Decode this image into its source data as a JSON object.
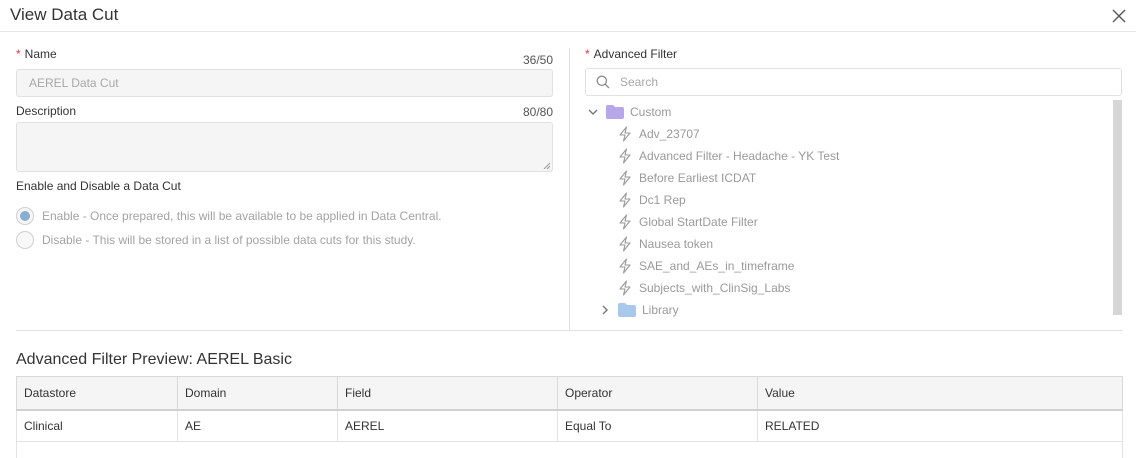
{
  "dialog": {
    "title": "View Data Cut"
  },
  "name_field": {
    "label": "Name",
    "counter": "36/50",
    "value": "AEREL Data Cut"
  },
  "description_field": {
    "label": "Description",
    "counter": "80/80",
    "value": ""
  },
  "enable_section": {
    "label": "Enable and Disable a Data Cut",
    "options": [
      {
        "label": "Enable - Once prepared, this will be available to be applied in Data Central.",
        "selected": true
      },
      {
        "label": "Disable - This will be stored in a list of possible data cuts for this study.",
        "selected": false
      }
    ]
  },
  "advanced_filter": {
    "label": "Advanced Filter",
    "search_placeholder": "Search",
    "folders": [
      {
        "name": "Custom",
        "expanded": true,
        "color": "#b7a6e8",
        "items": [
          "Adv_23707",
          "Advanced Filter - Headache - YK Test",
          "Before Earliest ICDAT",
          "Dc1 Rep",
          "Global StartDate Filter",
          "Nausea token",
          "SAE_and_AEs_in_timeframe",
          "Subjects_with_ClinSig_Labs"
        ]
      },
      {
        "name": "Library",
        "expanded": false,
        "color": "#a9c9ec",
        "items": []
      }
    ]
  },
  "preview": {
    "title": "Advanced Filter Preview: AEREL Basic",
    "columns": [
      "Datastore",
      "Domain",
      "Field",
      "Operator",
      "Value"
    ],
    "rows": [
      [
        "Clinical",
        "AE",
        "AEREL",
        "Equal To",
        "RELATED"
      ]
    ]
  },
  "colors": {
    "required": "#d9363e",
    "radio_selected": "#8aaed2"
  }
}
